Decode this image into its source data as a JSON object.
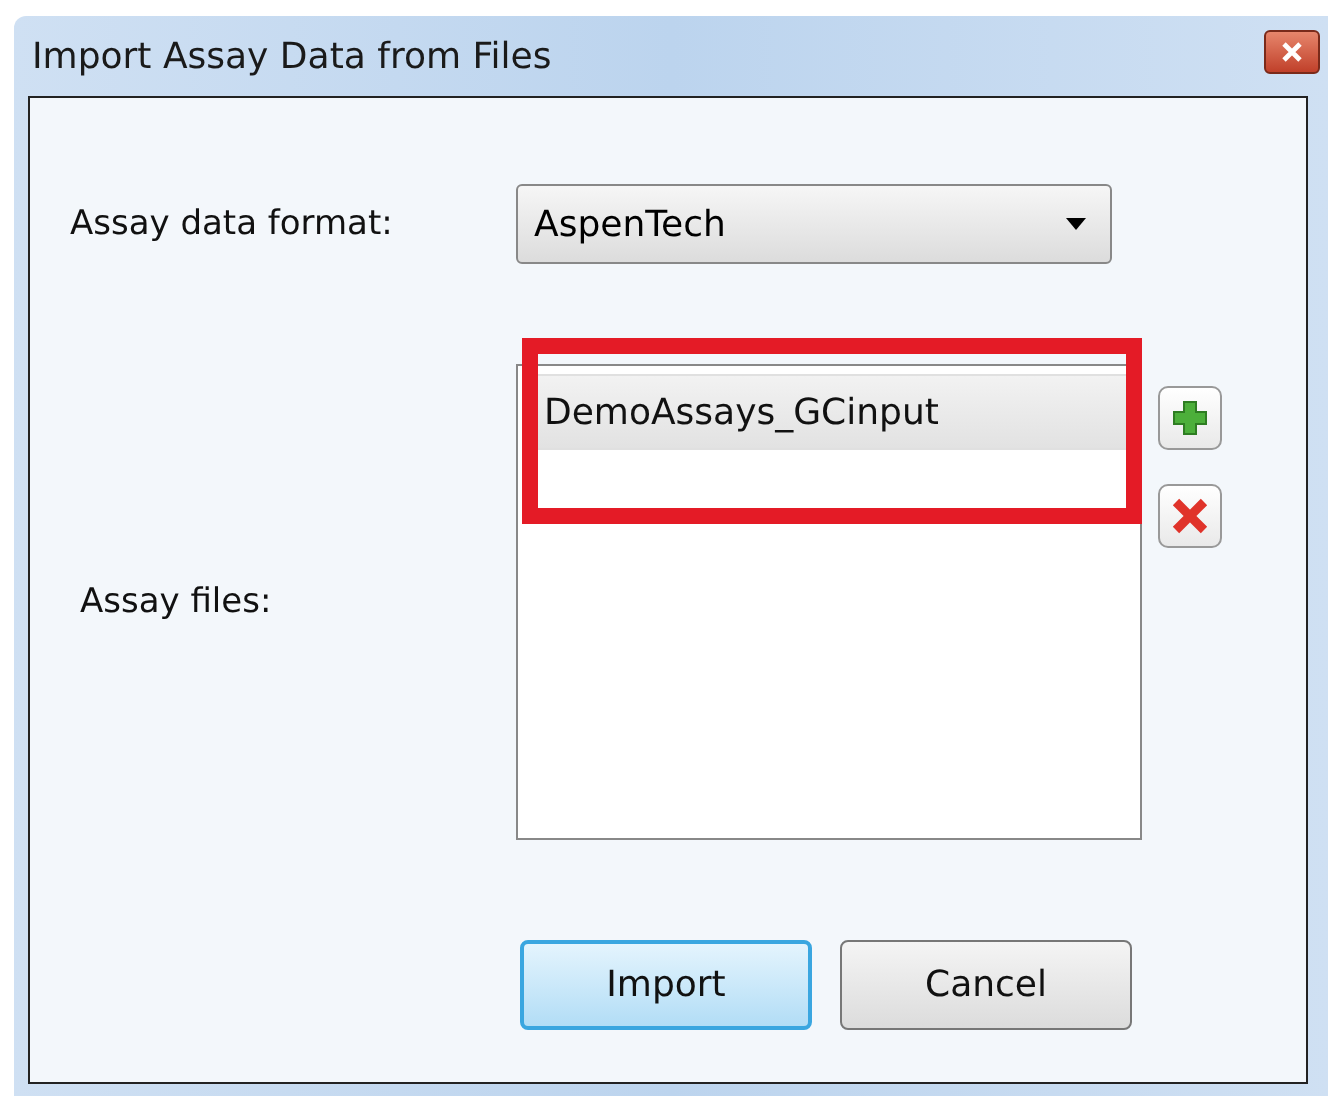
{
  "window": {
    "title": "Import Assay Data from Files"
  },
  "format": {
    "label": "Assay data format:",
    "value": "AspenTech"
  },
  "files": {
    "label": "Assay files:",
    "items": [
      {
        "name": "DemoAssays_GCinput",
        "selected": true
      }
    ]
  },
  "buttons": [
    {
      "label": "Import",
      "default": true
    },
    {
      "label": "Cancel",
      "default": false
    }
  ]
}
